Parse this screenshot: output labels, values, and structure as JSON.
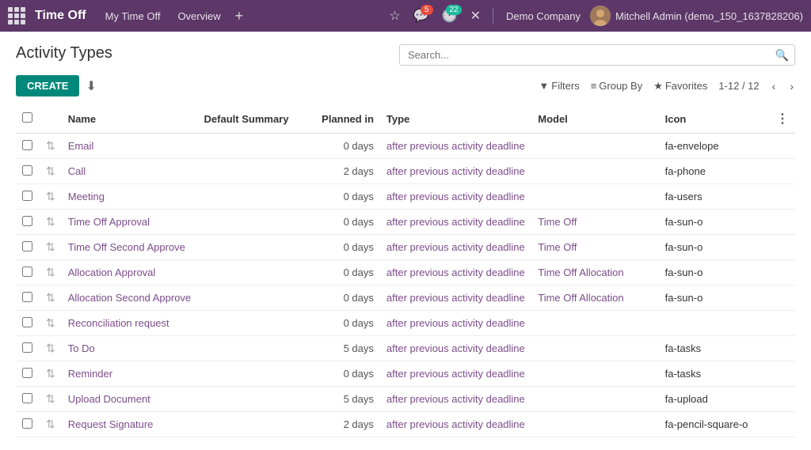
{
  "nav": {
    "app_icon": "grid-icon",
    "title": "Time Off",
    "links": [
      {
        "label": "My Time Off",
        "name": "my-time-off"
      },
      {
        "label": "Overview",
        "name": "overview"
      }
    ],
    "add_label": "+",
    "icons": [
      {
        "name": "star-icon",
        "symbol": "☆",
        "badge": null
      },
      {
        "name": "chat-icon",
        "symbol": "💬",
        "badge": "5"
      },
      {
        "name": "clock-icon",
        "symbol": "🕐",
        "badge": "22"
      },
      {
        "name": "close-icon",
        "symbol": "✕",
        "badge": null
      }
    ],
    "company": "Demo Company",
    "user": "Mitchell Admin (demo_150_1637828206)"
  },
  "page": {
    "title": "Activity Types"
  },
  "toolbar": {
    "create_label": "CREATE",
    "download_label": "⬇"
  },
  "search": {
    "placeholder": "Search..."
  },
  "filters": {
    "filters_label": "Filters",
    "group_by_label": "Group By",
    "favorites_label": "Favorites",
    "pagination": "1-12 / 12"
  },
  "table": {
    "columns": [
      {
        "label": "",
        "name": "col-checkbox"
      },
      {
        "label": "",
        "name": "col-drag"
      },
      {
        "label": "Name",
        "name": "col-name"
      },
      {
        "label": "Default Summary",
        "name": "col-default-summary"
      },
      {
        "label": "Planned in",
        "name": "col-planned"
      },
      {
        "label": "Type",
        "name": "col-type"
      },
      {
        "label": "Model",
        "name": "col-model"
      },
      {
        "label": "Icon",
        "name": "col-icon"
      },
      {
        "label": "⋮",
        "name": "col-menu"
      }
    ],
    "rows": [
      {
        "name": "Email",
        "default_summary": "",
        "planned_days": "0 days",
        "type": "after previous activity deadline",
        "model": "",
        "icon": "fa-envelope"
      },
      {
        "name": "Call",
        "default_summary": "",
        "planned_days": "2 days",
        "type": "after previous activity deadline",
        "model": "",
        "icon": "fa-phone"
      },
      {
        "name": "Meeting",
        "default_summary": "",
        "planned_days": "0 days",
        "type": "after previous activity deadline",
        "model": "",
        "icon": "fa-users"
      },
      {
        "name": "Time Off Approval",
        "default_summary": "",
        "planned_days": "0 days",
        "type": "after previous activity deadline",
        "model": "Time Off",
        "icon": "fa-sun-o"
      },
      {
        "name": "Time Off Second Approve",
        "default_summary": "",
        "planned_days": "0 days",
        "type": "after previous activity deadline",
        "model": "Time Off",
        "icon": "fa-sun-o"
      },
      {
        "name": "Allocation Approval",
        "default_summary": "",
        "planned_days": "0 days",
        "type": "after previous activity deadline",
        "model": "Time Off Allocation",
        "icon": "fa-sun-o"
      },
      {
        "name": "Allocation Second Approve",
        "default_summary": "",
        "planned_days": "0 days",
        "type": "after previous activity deadline",
        "model": "Time Off Allocation",
        "icon": "fa-sun-o"
      },
      {
        "name": "Reconciliation request",
        "default_summary": "",
        "planned_days": "0 days",
        "type": "after previous activity deadline",
        "model": "",
        "icon": ""
      },
      {
        "name": "To Do",
        "default_summary": "",
        "planned_days": "5 days",
        "type": "after previous activity deadline",
        "model": "",
        "icon": "fa-tasks"
      },
      {
        "name": "Reminder",
        "default_summary": "",
        "planned_days": "0 days",
        "type": "after previous activity deadline",
        "model": "",
        "icon": "fa-tasks"
      },
      {
        "name": "Upload Document",
        "default_summary": "",
        "planned_days": "5 days",
        "type": "after previous activity deadline",
        "model": "",
        "icon": "fa-upload"
      },
      {
        "name": "Request Signature",
        "default_summary": "",
        "planned_days": "2 days",
        "type": "after previous activity deadline",
        "model": "",
        "icon": "fa-pencil-square-o"
      }
    ]
  }
}
